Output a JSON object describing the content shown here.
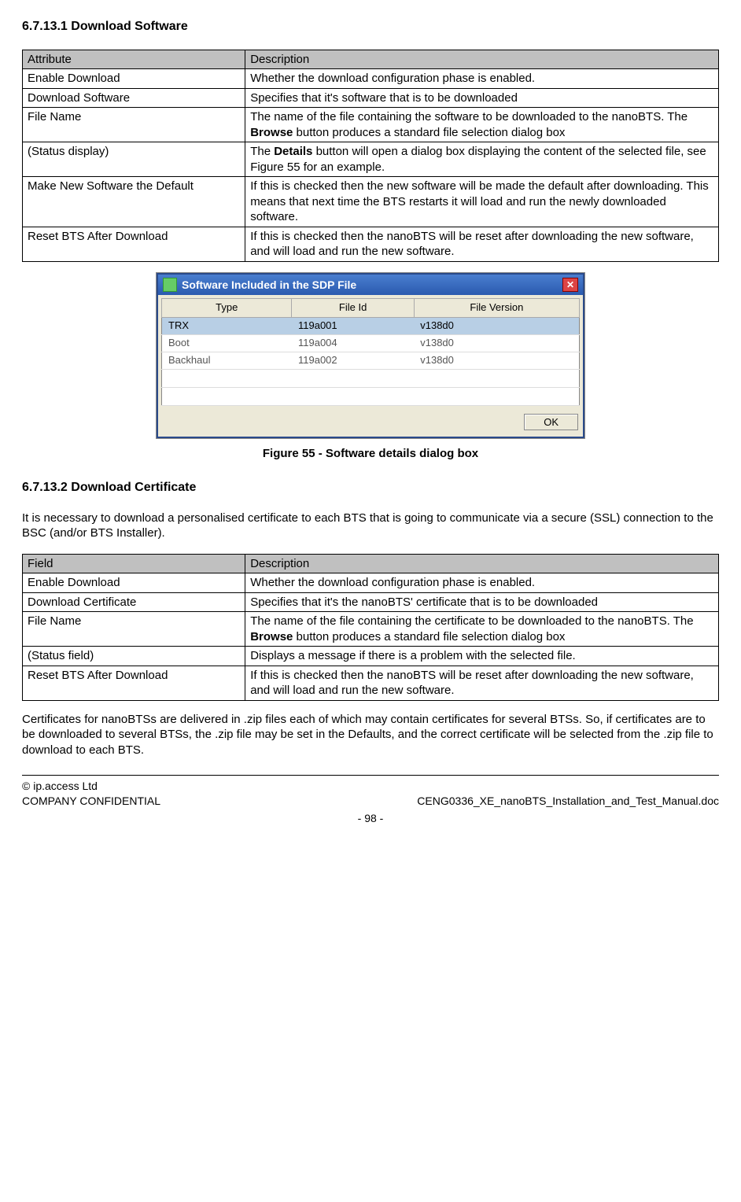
{
  "section1": {
    "number_title": "6.7.13.1 Download Software",
    "table": {
      "headers": [
        "Attribute",
        "Description"
      ],
      "rows": [
        {
          "attr": "Enable Download",
          "desc_plain": "Whether the download configuration phase is enabled."
        },
        {
          "attr": "Download Software",
          "desc_plain": "Specifies that it's software that is to be downloaded"
        },
        {
          "attr": "File Name",
          "desc_pre": "The name of the file containing the software to be downloaded to the nanoBTS. The ",
          "desc_bold": "Browse",
          "desc_post": " button produces a standard file selection dialog box"
        },
        {
          "attr": "(Status display)",
          "desc_pre": "The ",
          "desc_bold": "Details",
          "desc_post": " button will open a dialog box displaying the content of the selected file, see Figure 55 for an example."
        },
        {
          "attr": "Make New Software the Default",
          "desc_plain": "If this is checked then the new software will be made the default after downloading. This means that next time the BTS restarts it will load and run the newly downloaded software."
        },
        {
          "attr": "Reset BTS After Download",
          "desc_plain": "If this is checked then the nanoBTS will be reset after downloading the new software, and will load and run the new software."
        }
      ]
    }
  },
  "dialog": {
    "title": "Software Included in the SDP File",
    "columns": [
      "Type",
      "File Id",
      "File Version"
    ],
    "rows": [
      {
        "type": "TRX",
        "fileid": "119a001",
        "ver": "v138d0",
        "selected": true
      },
      {
        "type": "Boot",
        "fileid": "119a004",
        "ver": "v138d0",
        "selected": false
      },
      {
        "type": "Backhaul",
        "fileid": "119a002",
        "ver": "v138d0",
        "selected": false
      }
    ],
    "ok": "OK"
  },
  "figure_caption": "Figure 55 - Software details dialog box",
  "section2": {
    "number_title": "6.7.13.2 Download Certificate",
    "intro": "It is necessary to download a personalised certificate to each BTS that is going to communicate via a secure (SSL) connection to the BSC (and/or BTS Installer).",
    "table": {
      "headers": [
        "Field",
        "Description"
      ],
      "rows": [
        {
          "attr": "Enable Download",
          "desc_plain": "Whether the download configuration phase is enabled."
        },
        {
          "attr": "Download Certificate",
          "desc_plain": "Specifies that it's the nanoBTS' certificate that is to be downloaded"
        },
        {
          "attr": "File Name",
          "desc_pre": "The name of the file containing the certificate to be downloaded to the nanoBTS. The ",
          "desc_bold": "Browse",
          "desc_post": " button produces a standard file selection dialog box"
        },
        {
          "attr": "(Status field)",
          "desc_plain": "Displays a message if there is a problem with the selected file."
        },
        {
          "attr": "Reset BTS After Download",
          "desc_plain": "If this is checked then the nanoBTS will be reset after downloading the new software, and will load and run the new software."
        }
      ]
    },
    "outro": "Certificates for nanoBTSs are delivered in .zip files each of which may contain certificates for several BTSs. So, if certificates are to be downloaded to several BTSs, the .zip file may be set in the Defaults, and the correct certificate will be selected from the .zip file to download to each BTS."
  },
  "footer": {
    "copyright": "© ip.access Ltd",
    "confidential": "COMPANY CONFIDENTIAL",
    "docref": "CENG0336_XE_nanoBTS_Installation_and_Test_Manual.doc",
    "page": "- 98 -"
  }
}
